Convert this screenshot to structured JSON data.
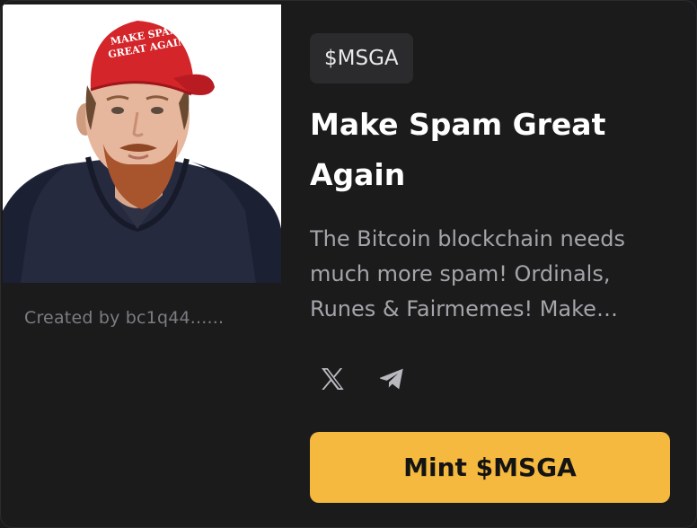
{
  "token": {
    "ticker": "$MSGA",
    "name": "Make Spam Great Again",
    "description": "The Bitcoin blockchain needs much more spam! Ordinals, Runes & Fairmemes! Make…",
    "creator": "Created by bc1q44......",
    "cap_text_line1": "MAKE SPAM",
    "cap_text_line2": "GREAT AGAIN"
  },
  "socials": [
    {
      "icon": "x-logo-icon"
    },
    {
      "icon": "telegram-icon"
    }
  ],
  "actions": {
    "mint_label": "Mint $MSGA"
  },
  "colors": {
    "background": "#1b1b1c",
    "accent": "#f4b93e",
    "ticker_bg": "#2b2b2d",
    "muted_text": "#a4a4aa"
  }
}
